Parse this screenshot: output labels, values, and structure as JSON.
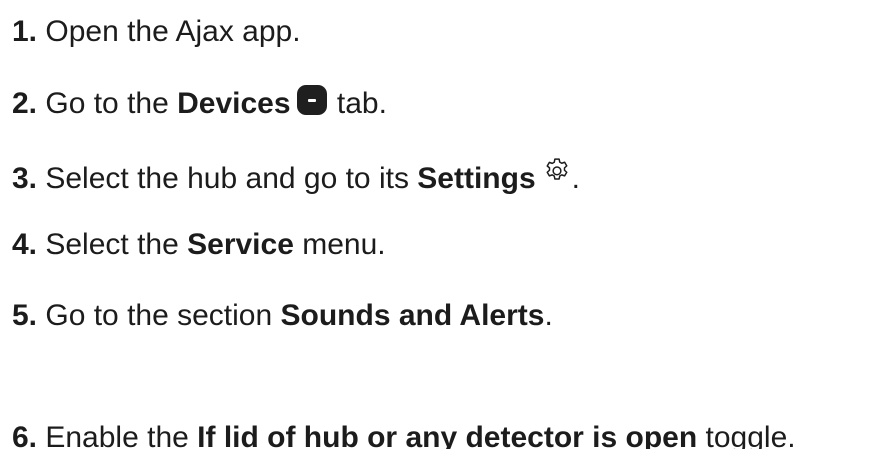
{
  "steps": [
    {
      "num": "1.",
      "pre": " Open the Ajax app.",
      "bold": "",
      "post": ""
    },
    {
      "num": "2.",
      "pre": " Go to the ",
      "bold": "Devices",
      "post": " tab."
    },
    {
      "num": "3.",
      "pre": " Select the hub and go to its ",
      "bold": "Settings",
      "post": "."
    },
    {
      "num": "4.",
      "pre": " Select the ",
      "bold": "Service",
      "post": " menu."
    },
    {
      "num": "5.",
      "pre": " Go to the section ",
      "bold": "Sounds and Alerts",
      "post": "."
    },
    {
      "num": "6.",
      "pre": " Enable the ",
      "bold": "If lid of hub or any detector is open",
      "post": " toggle."
    }
  ],
  "icons": {
    "devices": "devices-tab-icon",
    "settings": "gear-icon"
  }
}
